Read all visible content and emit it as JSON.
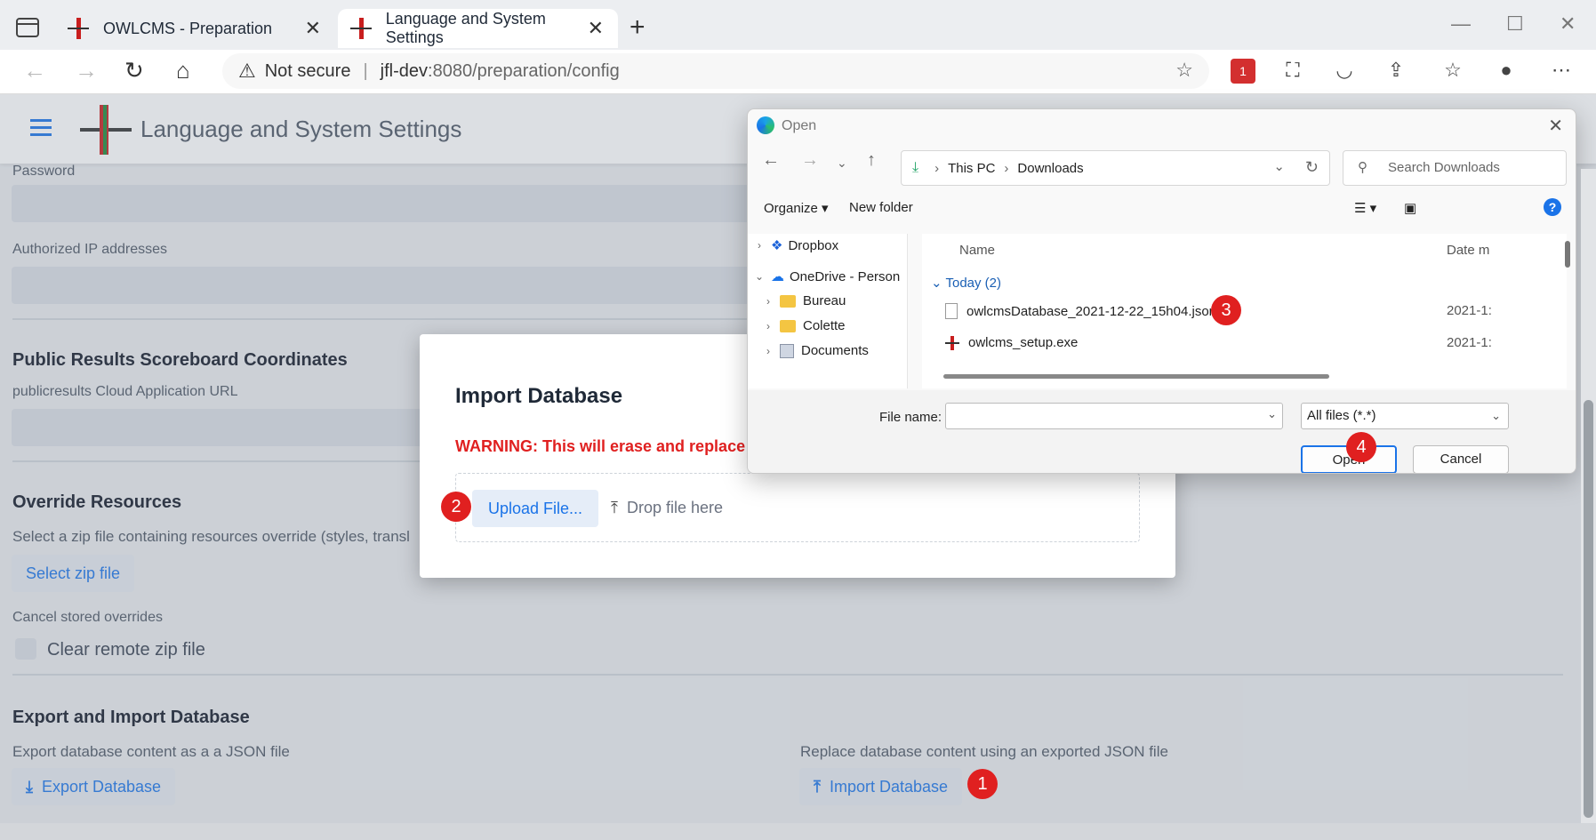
{
  "browser": {
    "tabs": [
      {
        "title": "OWLCMS - Preparation"
      },
      {
        "title": "Language and System Settings"
      }
    ],
    "address": {
      "security": "Not secure",
      "host": "jfl-dev",
      "path": ":8080/preparation/config"
    },
    "extension_badge": "1"
  },
  "app": {
    "title": "Language and System Settings"
  },
  "page": {
    "password_label": "Password",
    "ip_label": "Authorized IP addresses",
    "public_results": {
      "title": "Public Results Scoreboard Coordinates",
      "url_label": "publicresults Cloud Application URL"
    },
    "override": {
      "title": "Override Resources",
      "desc": "Select a zip file containing resources override (styles, transl",
      "select_button": "Select zip file",
      "cancel_label": "Cancel stored overrides",
      "clear_label": "Clear remote zip file"
    },
    "database": {
      "title": "Export and Import Database",
      "export_desc": "Export database content as a a JSON file",
      "export_button": "Export Database",
      "import_desc": "Replace database content using an exported JSON file",
      "import_button": "Import Database"
    }
  },
  "import_dialog": {
    "title": "Import Database",
    "warning": "WARNING: This will erase and replace a",
    "upload_button": "Upload File...",
    "drop_hint": "Drop file here"
  },
  "open_dialog": {
    "title": "Open",
    "breadcrumb": [
      "This PC",
      "Downloads"
    ],
    "search_placeholder": "Search Downloads",
    "organize": "Organize",
    "new_folder": "New folder",
    "nav": [
      "Dropbox",
      "OneDrive - Person",
      "Bureau",
      "Colette",
      "Documents"
    ],
    "columns": {
      "name": "Name",
      "date": "Date m"
    },
    "group": "Today (2)",
    "files": [
      {
        "name": "owlcmsDatabase_2021-12-22_15h04.json",
        "date": "2021-1:"
      },
      {
        "name": "owlcms_setup.exe",
        "date": "2021-1:"
      }
    ],
    "file_name_label": "File name:",
    "file_name_value": "",
    "filter": "All files (*.*)",
    "open_button": "Open",
    "cancel_button": "Cancel"
  },
  "badges": [
    "1",
    "2",
    "3",
    "4"
  ],
  "colors": {
    "accent": "#1a73e8",
    "warning": "#e02020",
    "badge": "#e02020"
  }
}
